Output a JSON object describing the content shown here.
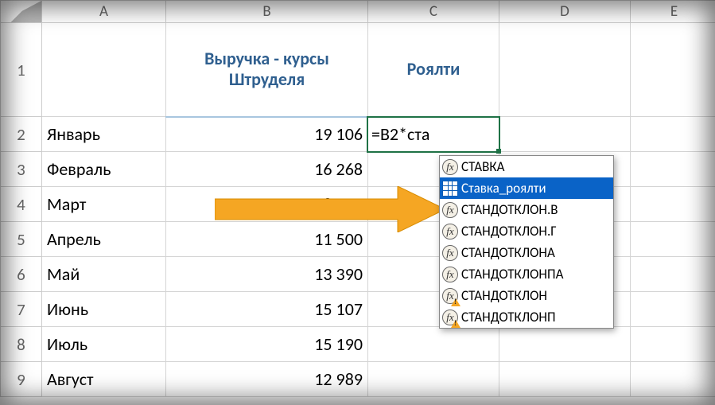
{
  "columns": [
    "A",
    "B",
    "C",
    "D",
    "E"
  ],
  "row_numbers": [
    1,
    2,
    3,
    4,
    5,
    6,
    7,
    8,
    9
  ],
  "headers": {
    "B": "Выручка - курсы Штруделя",
    "C": "Роялти"
  },
  "data": [
    {
      "month": "Январь",
      "value": "19 106"
    },
    {
      "month": "Февраль",
      "value": "16 268"
    },
    {
      "month": "Март",
      "value": "18 134"
    },
    {
      "month": "Апрель",
      "value": "11 500"
    },
    {
      "month": "Май",
      "value": "13 390"
    },
    {
      "month": "Июнь",
      "value": "15 107"
    },
    {
      "month": "Июль",
      "value": "15 190"
    },
    {
      "month": "Август",
      "value": "12 989"
    }
  ],
  "active_cell_formula": "=B2*ста",
  "autocomplete": {
    "items": [
      {
        "label": "СТАВКА",
        "icon": "fx"
      },
      {
        "label": "Ставка_роялти",
        "icon": "grid",
        "selected": true
      },
      {
        "label": "СТАНДОТКЛОН.В",
        "icon": "fx"
      },
      {
        "label": "СТАНДОТКЛОН.Г",
        "icon": "fx"
      },
      {
        "label": "СТАНДОТКЛОНА",
        "icon": "fx"
      },
      {
        "label": "СТАНДОТКЛОНПА",
        "icon": "fx"
      },
      {
        "label": "СТАНДОТКЛОН",
        "icon": "fx",
        "deprecated": true
      },
      {
        "label": "СТАНДОТКЛОНП",
        "icon": "fx",
        "deprecated": true
      }
    ]
  }
}
